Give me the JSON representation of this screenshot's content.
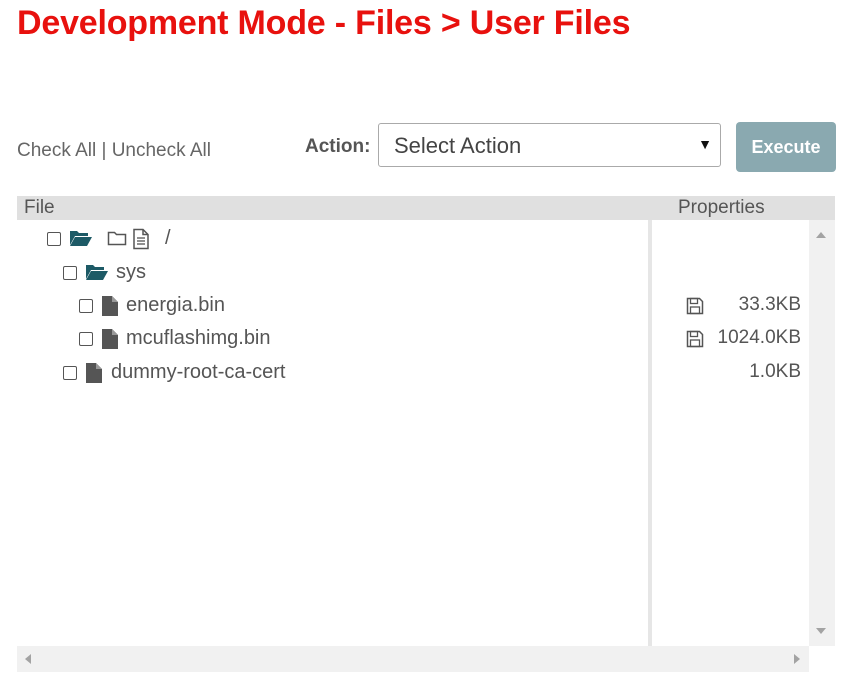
{
  "page": {
    "title": "Development Mode - Files > User Files"
  },
  "toolbar": {
    "check_all": "Check All",
    "separator": "|",
    "uncheck_all": "Uncheck All",
    "action_label": "Action:",
    "action_select": {
      "selected": "Select Action"
    },
    "execute_label": "Execute"
  },
  "table": {
    "columns": {
      "file": "File",
      "properties": "Properties"
    },
    "rows": [
      {
        "name": "/",
        "icon": "folder-open-icon",
        "size": "",
        "depth": 0
      },
      {
        "name": "sys",
        "icon": "folder-open-icon",
        "size": "",
        "depth": 1
      },
      {
        "name": "energia.bin",
        "icon": "file-icon",
        "size": "33.3KB",
        "depth": 2,
        "save_icon": "floppy-disk-icon"
      },
      {
        "name": "mcuflashimg.bin",
        "icon": "file-icon",
        "size": "1024.0KB",
        "depth": 2,
        "save_icon": "floppy-disk-icon"
      },
      {
        "name": "dummy-root-ca-cert",
        "icon": "file-icon",
        "size": "1.0KB",
        "depth": 1
      }
    ]
  },
  "colors": {
    "title": "#e8110e",
    "execute_button": "#8aa9b0",
    "folder_icon": "#1d5a66",
    "header_bg": "#e0e0e0"
  }
}
